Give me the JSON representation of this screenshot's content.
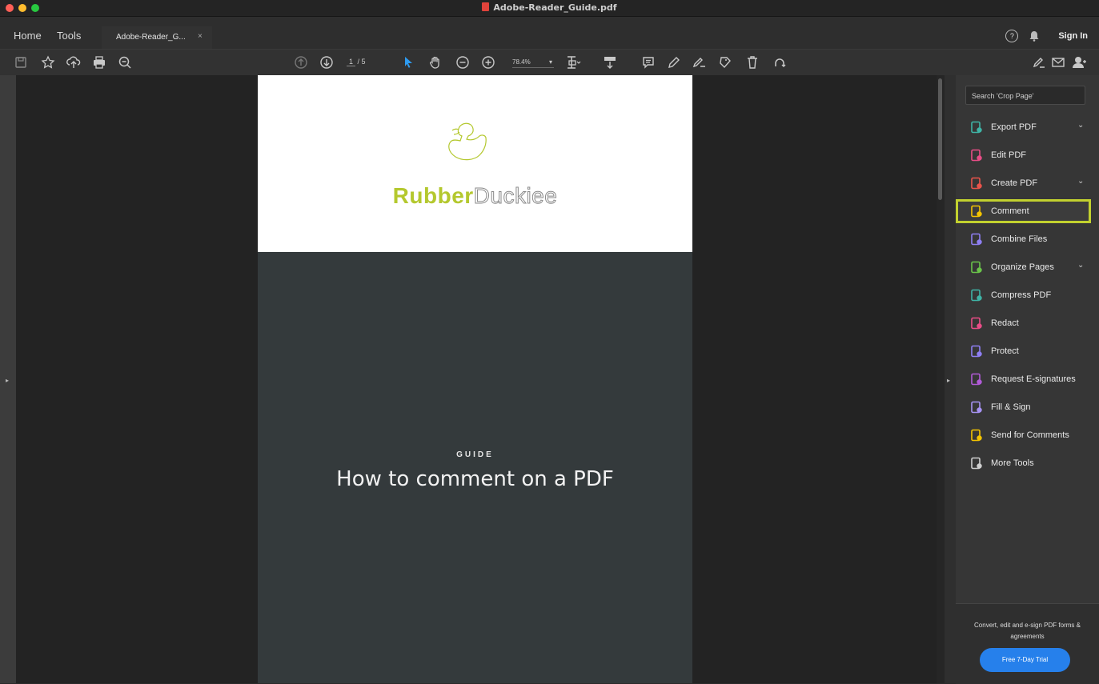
{
  "window": {
    "title": "Adobe-Reader_Guide.pdf"
  },
  "tabs": {
    "home": "Home",
    "tools": "Tools",
    "document": "Adobe-Reader_G...",
    "close": "×"
  },
  "header_right": {
    "help": "?",
    "sign_in": "Sign In"
  },
  "toolbar": {
    "page_current": "1",
    "page_total": "/ 5",
    "zoom": "78.4%",
    "left_icons": [
      "save-icon",
      "star-icon",
      "upload-icon",
      "print-icon",
      "zoom-out-icon"
    ],
    "nav_icons": [
      "prev-page-icon",
      "next-page-icon"
    ],
    "mid_icons": [
      "select-arrow-icon",
      "hand-icon",
      "zoom-minus-icon",
      "zoom-plus-icon"
    ],
    "right_icons": [
      "fit-page-icon",
      "scroll-mode-icon",
      "comment-note-icon",
      "pencil-icon",
      "sign-icon",
      "stamp-icon",
      "trash-icon",
      "rotate-icon"
    ],
    "far_right_icons": [
      "fill-sign-icon",
      "mail-icon",
      "share-user-icon"
    ]
  },
  "document": {
    "logo_part1": "Rubber",
    "logo_part2": "Duckiee",
    "label": "GUIDE",
    "headline": "How to comment on a PDF"
  },
  "panel": {
    "search_placeholder": "Search 'Crop Page'",
    "tools": [
      {
        "label": "Export PDF",
        "icon": "export-pdf-icon",
        "color": "#3fb4a6",
        "chevron": true
      },
      {
        "label": "Edit PDF",
        "icon": "edit-pdf-icon",
        "color": "#e94d87",
        "chevron": false
      },
      {
        "label": "Create PDF",
        "icon": "create-pdf-icon",
        "color": "#e9544b",
        "chevron": true
      },
      {
        "label": "Comment",
        "icon": "comment-icon",
        "color": "#f4c400",
        "chevron": false,
        "highlighted": true
      },
      {
        "label": "Combine Files",
        "icon": "combine-files-icon",
        "color": "#8f7ff3",
        "chevron": false
      },
      {
        "label": "Organize Pages",
        "icon": "organize-pages-icon",
        "color": "#6ac44a",
        "chevron": true
      },
      {
        "label": "Compress PDF",
        "icon": "compress-pdf-icon",
        "color": "#3fb4a6",
        "chevron": false
      },
      {
        "label": "Redact",
        "icon": "redact-icon",
        "color": "#e94d87",
        "chevron": false
      },
      {
        "label": "Protect",
        "icon": "protect-icon",
        "color": "#8f7ff3",
        "chevron": false
      },
      {
        "label": "Request E-signatures",
        "icon": "request-esignatures-icon",
        "color": "#b25bd8",
        "chevron": false
      },
      {
        "label": "Fill & Sign",
        "icon": "fill-sign-tool-icon",
        "color": "#a793f4",
        "chevron": false
      },
      {
        "label": "Send for Comments",
        "icon": "send-for-comments-icon",
        "color": "#f4c400",
        "chevron": false
      },
      {
        "label": "More Tools",
        "icon": "more-tools-icon",
        "color": "#cfcfcf",
        "chevron": false
      }
    ],
    "promo_text": "Convert, edit and e-sign PDF forms & agreements",
    "trial_button": "Free 7-Day Trial"
  },
  "colors": {
    "highlight": "#c2d12f",
    "accent_blue": "#2680eb",
    "logo_green": "#b4c82e"
  }
}
